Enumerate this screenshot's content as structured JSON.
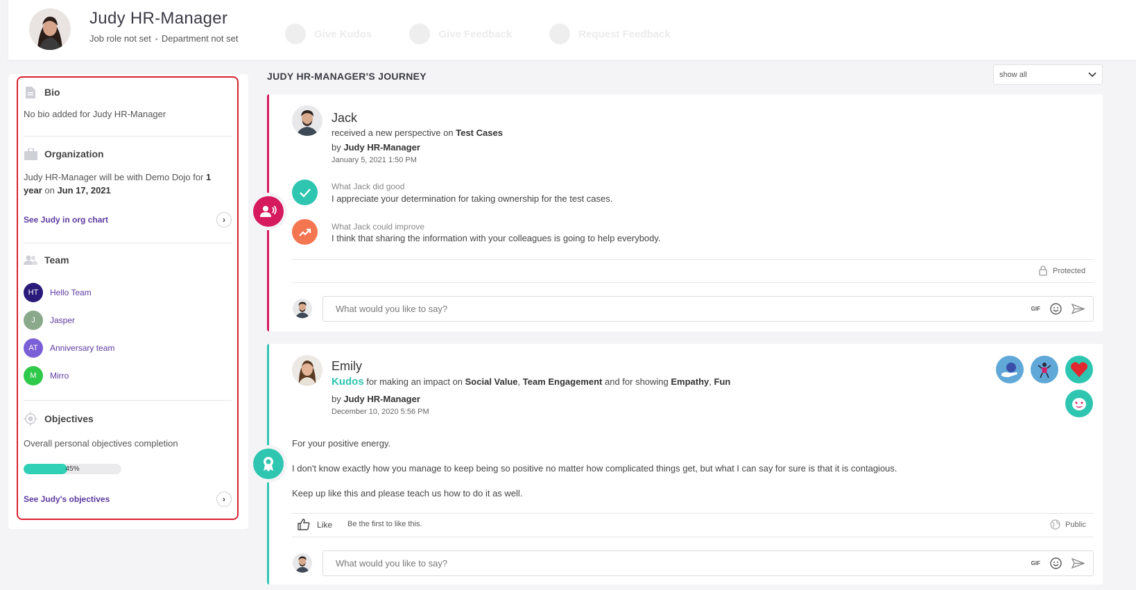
{
  "header": {
    "name": "Judy HR-Manager",
    "job_role": "Job role not set",
    "department": "Department not set",
    "actions": [
      {
        "label": "Give Kudos"
      },
      {
        "label": "Give Feedback"
      },
      {
        "label": "Request Feedback"
      }
    ]
  },
  "sidebar": {
    "bio": {
      "title": "Bio",
      "text": "No bio added for Judy HR-Manager"
    },
    "organization": {
      "title": "Organization",
      "text_before": "Judy HR-Manager will be with Demo Dojo for ",
      "duration": "1 year",
      "text_on": " on ",
      "date": "Jun 17, 2021",
      "link": "See Judy in org chart"
    },
    "team": {
      "title": "Team",
      "items": [
        {
          "initials": "HT",
          "name": "Hello Team",
          "color": "#2a1a7a"
        },
        {
          "initials": "J",
          "name": "Jasper",
          "color": "#8aa88a"
        },
        {
          "initials": "AT",
          "name": "Anniversary team",
          "color": "#7b5fd6"
        },
        {
          "initials": "M",
          "name": "Mirro",
          "color": "#2fc94a"
        }
      ]
    },
    "objectives": {
      "title": "Objectives",
      "text": "Overall personal objectives completion",
      "progress": 45,
      "progress_label": "45%",
      "link": "See Judy's objectives"
    }
  },
  "journey": {
    "title": "JUDY HR-MANAGER'S JOURNEY",
    "filter": "show all"
  },
  "post1": {
    "author": "Jack",
    "action": "received a new perspective on",
    "topic": "Test Cases",
    "by_prefix": "by",
    "by": "Judy HR-Manager",
    "date": "January 5, 2021 1:50 PM",
    "good_label": "What Jack did good",
    "good_text": "I appreciate your determination for taking ownership for the test cases.",
    "improve_label": "What Jack could improve",
    "improve_text": "I think that sharing the information with your colleagues is going to help everybody.",
    "visibility": "Protected",
    "comment_placeholder": "What would you like to say?",
    "accent": "#d61a5e"
  },
  "post2": {
    "author": "Emily",
    "kudos": "Kudos",
    "text1": " for making an impact on ",
    "value1": "Social Value",
    "sep1": ", ",
    "value2": "Team Engagement",
    "text2": " and for showing ",
    "value3": "Empathy",
    "sep2": ", ",
    "value4": "Fun",
    "by_prefix": "by",
    "by": "Judy HR-Manager",
    "date": "December 10, 2020 5:56 PM",
    "para1": "For your positive energy.",
    "para2": "I don't know exactly how you manage to keep being so positive no matter how complicated things get, but what I can say for sure is that it is  contagious.",
    "para3": "Keep up like this and please teach us how to do it as well.",
    "like_label": "Like",
    "like_status": "Be the first to like this.",
    "visibility": "Public",
    "comment_placeholder": "What would you like to say?",
    "gif_label": "GIF",
    "accent": "#2ec5b1"
  }
}
